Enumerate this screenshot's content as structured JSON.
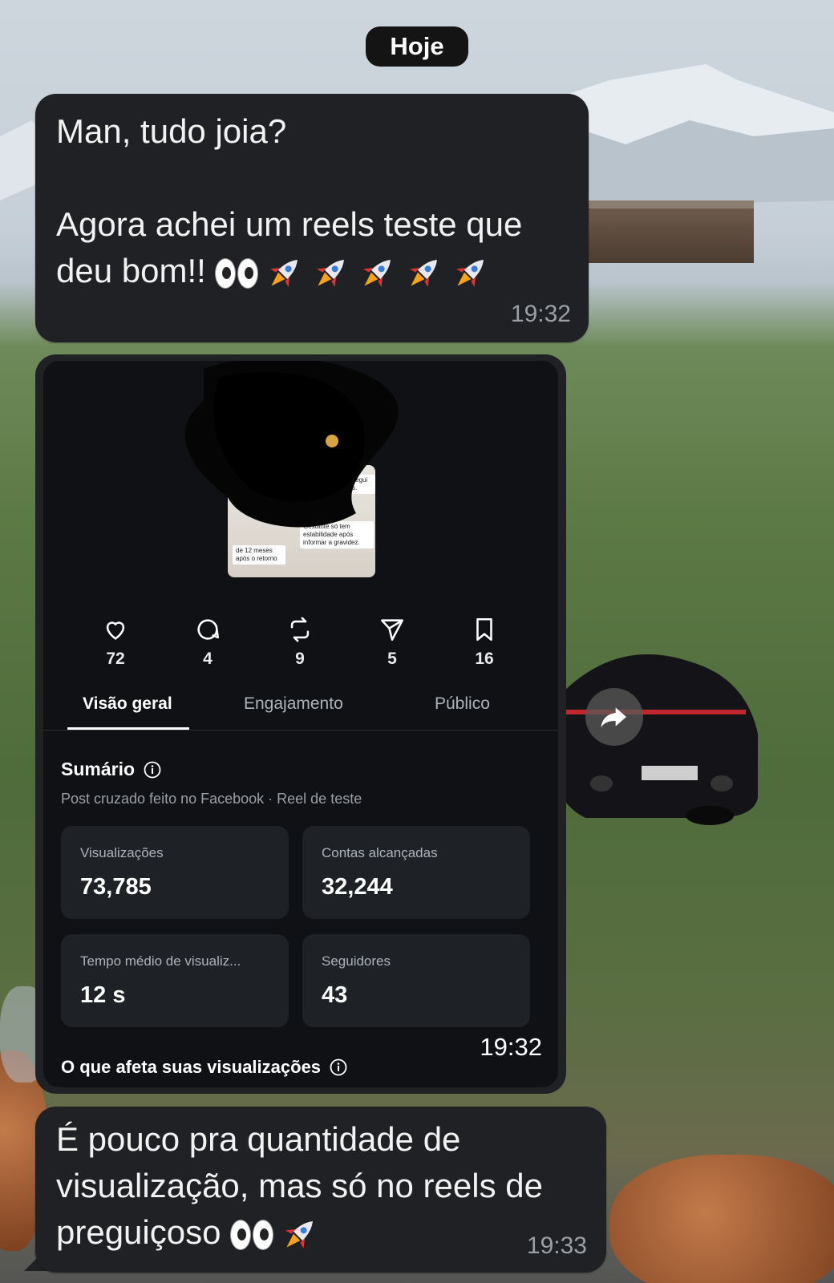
{
  "date_divider": "Hoje",
  "messages": [
    {
      "text": "Man, tudo joia?\n\nAgora achei um reels teste que\ndeu bom!!",
      "emojis": [
        "eyes",
        "rocket",
        "rocket",
        "rocket",
        "rocket",
        "rocket"
      ],
      "time": "19:32"
    },
    {
      "time": "19:32",
      "screenshot": {
        "thumbnail_captions": [
          "de 12 meses após o retorno",
          "Gestante só tem estabilidade após informar a gravidez.",
          "para consegui atrasados."
        ],
        "stats": [
          {
            "icon": "heart-icon",
            "value": "72"
          },
          {
            "icon": "comment-icon",
            "value": "4"
          },
          {
            "icon": "repost-icon",
            "value": "9"
          },
          {
            "icon": "send-icon",
            "value": "5"
          },
          {
            "icon": "bookmark-icon",
            "value": "16"
          }
        ],
        "tabs": [
          "Visão geral",
          "Engajamento",
          "Público"
        ],
        "active_tab": "Visão geral",
        "summary_title": "Sumário",
        "summary_subtitle": "Post cruzado feito no Facebook · Reel de teste",
        "cards": [
          {
            "label": "Visualizações",
            "value": "73,785"
          },
          {
            "label": "Contas alcançadas",
            "value": "32,244"
          },
          {
            "label": "Tempo médio de visualiz...",
            "value": "12 s"
          },
          {
            "label": "Seguidores",
            "value": "43"
          }
        ],
        "affects_title": "O que afeta suas visualizações"
      }
    },
    {
      "text": "É pouco pra quantidade de visualização, mas só no reels de preguiçoso",
      "emojis": [
        "eyes",
        "rocket"
      ],
      "time": "19:33"
    }
  ],
  "colors": {
    "bubble": "#202124",
    "screenshot_bg": "#0f1114",
    "card": "#1e2125"
  }
}
